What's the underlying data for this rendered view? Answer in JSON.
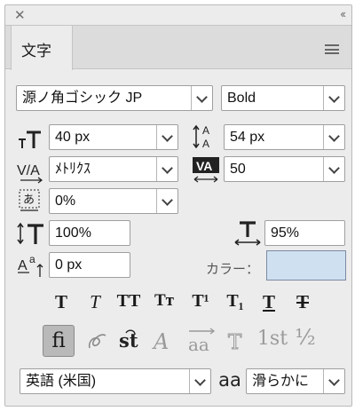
{
  "panel": {
    "close_glyph": "✕",
    "collapse_glyph": "‹‹",
    "tab_label": "文字"
  },
  "font": {
    "family": "源ノ角ゴシック JP",
    "style": "Bold"
  },
  "metrics": {
    "size": "40 px",
    "leading": "54 px",
    "kerning": "ﾒﾄﾘｸｽ",
    "tracking": "50",
    "tsume": "0%",
    "vertical_scale": "100%",
    "horizontal_scale": "95%",
    "baseline_shift": "0 px"
  },
  "color_label": "カラー：",
  "color_value": "#cfe0f0",
  "type_buttons": [
    "T",
    "T",
    "TT",
    "Tт",
    "T¹",
    "T₁",
    "T",
    "T"
  ],
  "opentype": {
    "ligature": "fi",
    "ordinal": "1st",
    "fraction": "½"
  },
  "language": "英語 (米国)",
  "antialias": "滑らかに",
  "aa_glyph": "aa"
}
